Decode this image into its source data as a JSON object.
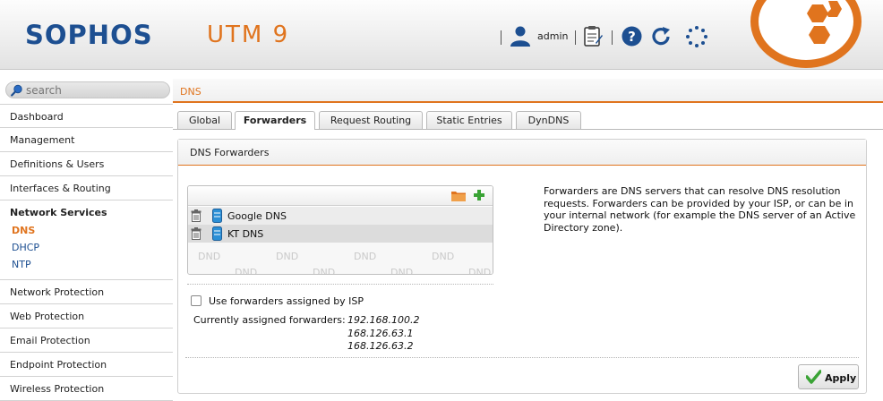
{
  "header": {
    "logo": "SOPHOS",
    "product": "UTM 9",
    "user": "admin",
    "icons": [
      "user-icon",
      "clipboard-icon",
      "help-icon",
      "refresh-icon",
      "activity-icon"
    ],
    "accent_color": "#e0741e",
    "brand_color": "#1d4f91"
  },
  "sidebar": {
    "search_placeholder": "search",
    "items_top": [
      "Dashboard",
      "Management",
      "Definitions & Users",
      "Interfaces & Routing"
    ],
    "group": {
      "title": "Network Services",
      "subs": [
        "DNS",
        "DHCP",
        "NTP"
      ],
      "active": "DNS"
    },
    "items_bottom": [
      "Network Protection",
      "Web Protection",
      "Email Protection",
      "Endpoint Protection",
      "Wireless Protection"
    ]
  },
  "breadcrumb": "DNS",
  "tabs": [
    "Global",
    "Forwarders",
    "Request Routing",
    "Static Entries",
    "DynDNS"
  ],
  "active_tab": "Forwarders",
  "panel": {
    "title": "DNS Forwarders",
    "forwarders": [
      "Google DNS",
      "KT DNS"
    ],
    "dnd_text": "DND",
    "help": "Forwarders are DNS servers that can resolve DNS resolution requests. Forwarders can be provided by your ISP, or can be in your internal network (for example the DNS server of an Active Directory zone).",
    "isp_checkbox_label": "Use forwarders assigned by ISP",
    "isp_checked": false,
    "current_label": "Currently assigned forwarders:",
    "current_values": [
      "192.168.100.2",
      "168.126.63.1",
      "168.126.63.2"
    ],
    "apply_label": "Apply"
  }
}
